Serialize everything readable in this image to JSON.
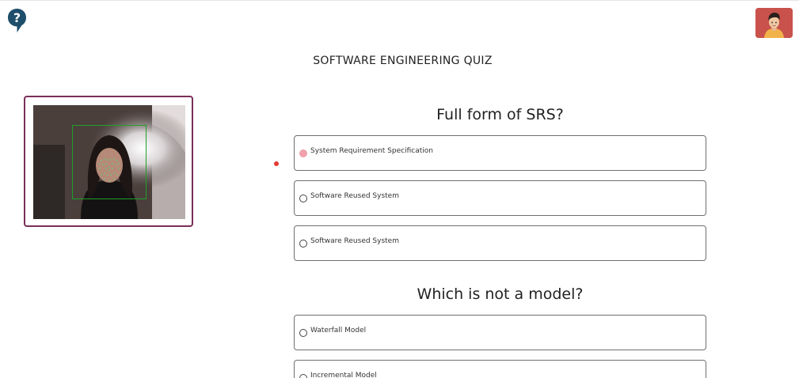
{
  "header": {
    "help_icon": "help-question-icon",
    "avatar_icon": "user-avatar-icon"
  },
  "quiz": {
    "title": "SOFTWARE ENGINEERING QUIZ"
  },
  "camera": {
    "icon": "face-detection-feed"
  },
  "questions": [
    {
      "text": "Full form of SRS?",
      "options": [
        {
          "label": "System Requirement Specification",
          "selected": true
        },
        {
          "label": "Software Reused System",
          "selected": false
        },
        {
          "label": "Software Reused System",
          "selected": false
        }
      ]
    },
    {
      "text": "Which is not a model?",
      "options": [
        {
          "label": "Waterfall Model",
          "selected": false
        },
        {
          "label": "Incremental Model",
          "selected": false
        }
      ]
    }
  ],
  "colors": {
    "accent": "#7a2f58",
    "help_icon": "#1f4e6b",
    "avatar_bg": "#c9524c",
    "face_box": "#1fa02a",
    "selected_radio": "#f1a1ab",
    "indicator_dot": "#e53935"
  }
}
